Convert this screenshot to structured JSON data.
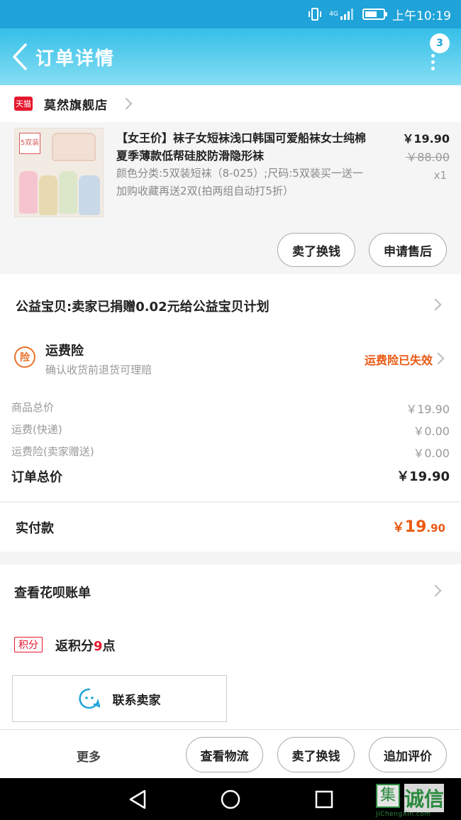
{
  "status_bar": {
    "time": "上午10:19",
    "signal": "4G"
  },
  "header": {
    "title": "订单详情",
    "badge_count": "3"
  },
  "store": {
    "platform_icon": "天猫",
    "name": "莫然旗舰店"
  },
  "product": {
    "image_tag": "5双装",
    "title": "【女王价】袜子女短袜浅口韩国可爱船袜女士纯棉夏季薄款低帮硅胶防滑隐形袜",
    "sku": "颜色分类:5双装短袜（8-025）;尺码:5双装买一送一加购收藏再送2双(拍两组自动打5折）",
    "price": "￥19.90",
    "original_price": "￥88.00",
    "quantity": "x1",
    "buttons": {
      "sold_exchange": "卖了换钱",
      "after_sale": "申请售后"
    }
  },
  "charity": {
    "text": "公益宝贝:卖家已捐赠0.02元给公益宝贝计划"
  },
  "insurance": {
    "icon": "险",
    "title": "运费险",
    "subtitle": "确认收货前退货可理赔",
    "status": "运费险已失效",
    "status_color": "#ea5a14"
  },
  "fees": [
    {
      "label": "商品总价",
      "value": "￥19.90"
    },
    {
      "label": "运费(快递)",
      "value": "￥0.00"
    },
    {
      "label": "运费险(卖家赠送)",
      "value": "￥0.00"
    }
  ],
  "order_total": {
    "label": "订单总价",
    "value": "￥19.90"
  },
  "paid": {
    "label": "实付款",
    "currency": "￥",
    "integer": "19",
    "decimal": ".90"
  },
  "huabei": {
    "label": "查看花呗账单"
  },
  "points": {
    "tag": "积分",
    "prefix": "返积分",
    "number": "9",
    "suffix": "点"
  },
  "contact": {
    "label": "联系卖家"
  },
  "action_bar": {
    "more": "更多",
    "logistics": "查看物流",
    "sell": "卖了换钱",
    "review": "追加评价"
  },
  "watermark": {
    "text": "诚信",
    "box": "集",
    "url": "JiChengXin.com"
  },
  "colors": {
    "accent": "#1fa3d8",
    "price_orange": "#ea5a14",
    "tmall_red": "#e4182d"
  }
}
